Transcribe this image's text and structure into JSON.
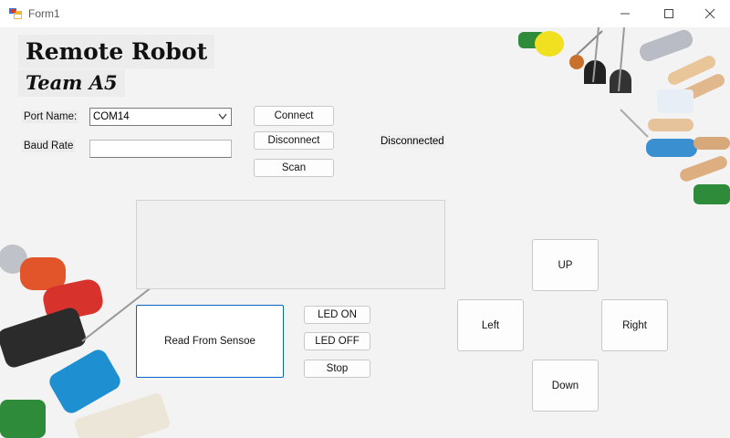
{
  "window": {
    "title": "Form1",
    "controls": {
      "minimize_icon": "minimize-icon",
      "maximize_icon": "maximize-icon",
      "close_icon": "close-icon"
    }
  },
  "header": {
    "title": "Remote Robot",
    "subtitle": "Team A5"
  },
  "connection": {
    "port_label": "Port Name:",
    "port_value": "COM14",
    "baud_label": "Baud Rate",
    "baud_value": "",
    "connect_label": "Connect",
    "disconnect_label": "Disconnect",
    "scan_label": "Scan",
    "status_text": "Disconnected"
  },
  "sensor": {
    "read_label": "Read From Sensoe"
  },
  "led": {
    "on_label": "LED ON",
    "off_label": "LED OFF",
    "stop_label": "Stop"
  },
  "direction": {
    "up_label": "UP",
    "left_label": "Left",
    "right_label": "Right",
    "down_label": "Down"
  },
  "colors": {
    "accent": "#0a64c8",
    "window_bg": "#f3f3f3"
  }
}
